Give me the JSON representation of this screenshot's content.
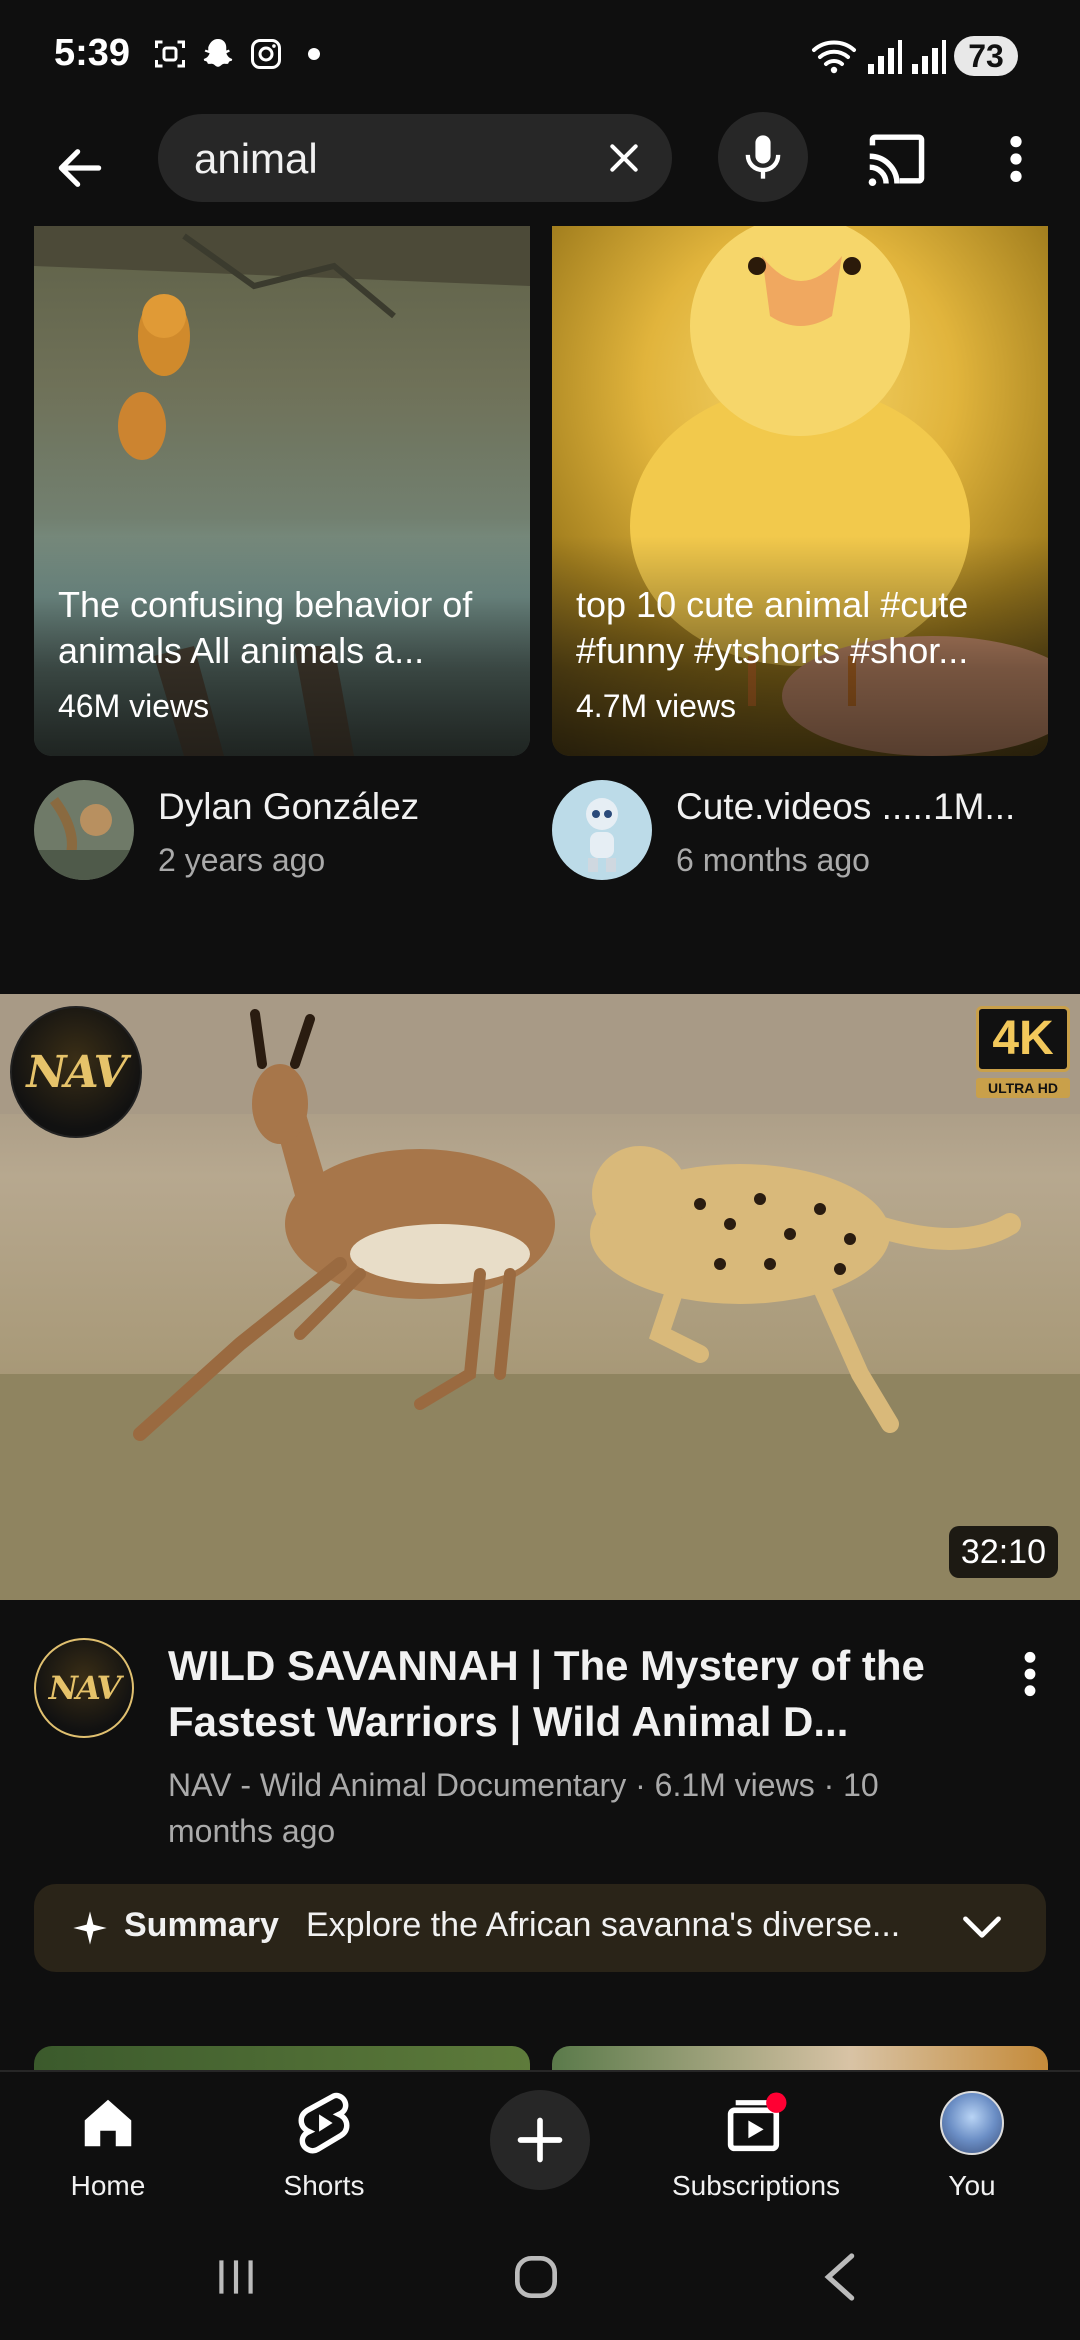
{
  "status_bar": {
    "time": "5:39",
    "battery": "73",
    "icons_left": [
      "screenshot-icon",
      "snapchat-icon",
      "instagram-icon",
      "dot-icon"
    ],
    "icons_right": [
      "wifi-icon",
      "signal-icon",
      "signal-icon"
    ]
  },
  "search": {
    "query": "animal"
  },
  "shorts": [
    {
      "title": "The confusing behavior of animals All animals a...",
      "views": "46M views",
      "channel": "Dylan González",
      "age": "2 years ago"
    },
    {
      "title": "top 10 cute animal #cute #funny #ytshorts #shor...",
      "views": "4.7M views",
      "channel": "Cute.videos .....1M...",
      "age": "6 months ago"
    }
  ],
  "video": {
    "logo_text": "NAV",
    "badge_top": "4K",
    "badge_bottom": "ULTRA HD",
    "duration": "32:10",
    "title": "WILD SAVANNAH | The Mystery of the Fastest Warriors | Wild Animal D...",
    "meta": "NAV - Wild Animal Documentary · 6.1M views · 10 months ago"
  },
  "summary": {
    "label": "Summary",
    "text": "Explore the African savanna's diverse..."
  },
  "bottom_nav": {
    "home": "Home",
    "shorts": "Shorts",
    "subscriptions": "Subscriptions",
    "you": "You"
  },
  "colors": {
    "background": "#0f0f0f",
    "surface": "#272727",
    "summary_bg": "#2a2418",
    "notification_dot": "#ff0033",
    "badge_gold": "#c9a04a"
  }
}
